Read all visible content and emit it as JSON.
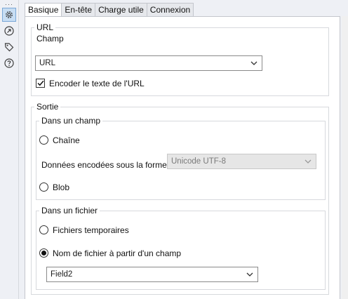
{
  "tabs": [
    {
      "label": "Basique",
      "active": true
    },
    {
      "label": "En-tête",
      "active": false
    },
    {
      "label": "Charge utile",
      "active": false
    },
    {
      "label": "Connexion",
      "active": false
    }
  ],
  "sidebar": {
    "icons": [
      "gear-icon",
      "connection-icon",
      "tag-icon",
      "help-icon"
    ],
    "active_icon": "gear-icon"
  },
  "url_group": {
    "legend": "URL",
    "field_label": "Champ",
    "field_value": "URL",
    "encode_label": "Encoder le texte de l'URL",
    "encode_checked": true
  },
  "output_group": {
    "legend": "Sortie",
    "field_section": {
      "legend": "Dans un champ",
      "string_label": "Chaîne",
      "string_selected": false,
      "encoding_label": "Données encodées sous la forme",
      "encoding_value": "Unicode UTF-8",
      "encoding_disabled": true,
      "blob_label": "Blob",
      "blob_selected": false
    },
    "file_section": {
      "legend": "Dans un fichier",
      "temp_label": "Fichiers temporaires",
      "temp_selected": false,
      "from_field_label": "Nom de fichier à partir d'un champ",
      "from_field_selected": true,
      "field_value": "Field2"
    }
  },
  "colors": {
    "active_icon_bg": "#c7ddf3",
    "panel_bg": "#ffffff",
    "chrome_bg": "#eef0f5"
  }
}
